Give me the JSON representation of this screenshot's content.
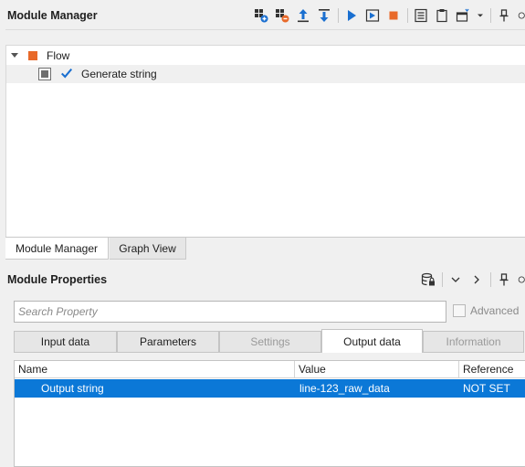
{
  "module_manager": {
    "title": "Module Manager",
    "toolbar_icons": [
      "add-module-icon",
      "remove-module-icon",
      "move-up-icon",
      "move-down-icon",
      "run-icon",
      "run-step-icon",
      "stop-icon",
      "list-view-icon",
      "clipboard-icon",
      "window-menu-icon",
      "chevron-down-icon",
      "pin-icon",
      "close-icon"
    ],
    "tree": [
      {
        "label": "Flow",
        "icon": "flow-square-icon",
        "color": "#e8692a"
      },
      {
        "label": "Generate string",
        "icon": "checkmark-icon",
        "color": "#1a6fd0"
      }
    ],
    "tabs": [
      {
        "label": "Module Manager",
        "active": true
      },
      {
        "label": "Graph View",
        "active": false
      }
    ]
  },
  "module_properties": {
    "title": "Module Properties",
    "toolbar_icons": [
      "database-lock-icon",
      "chevron-down-icon",
      "chevron-right-icon",
      "pin-icon",
      "close-icon"
    ],
    "search": {
      "placeholder": "Search Property",
      "value": ""
    },
    "advanced": {
      "label": "Advanced",
      "checked": false,
      "enabled": false
    },
    "tabs": [
      {
        "label": "Input data",
        "enabled": true,
        "active": false
      },
      {
        "label": "Parameters",
        "enabled": true,
        "active": false
      },
      {
        "label": "Settings",
        "enabled": false,
        "active": false
      },
      {
        "label": "Output data",
        "enabled": true,
        "active": true
      },
      {
        "label": "Information",
        "enabled": false,
        "active": false
      }
    ],
    "table": {
      "columns": [
        "Name",
        "Value",
        "Reference"
      ],
      "rows": [
        {
          "name": "Output string",
          "value": "line-123_raw_data",
          "reference": "NOT SET",
          "selected": true
        }
      ]
    }
  },
  "colors": {
    "accent": "#0b78d7",
    "flow": "#e8692a",
    "check": "#1a6fd0"
  }
}
